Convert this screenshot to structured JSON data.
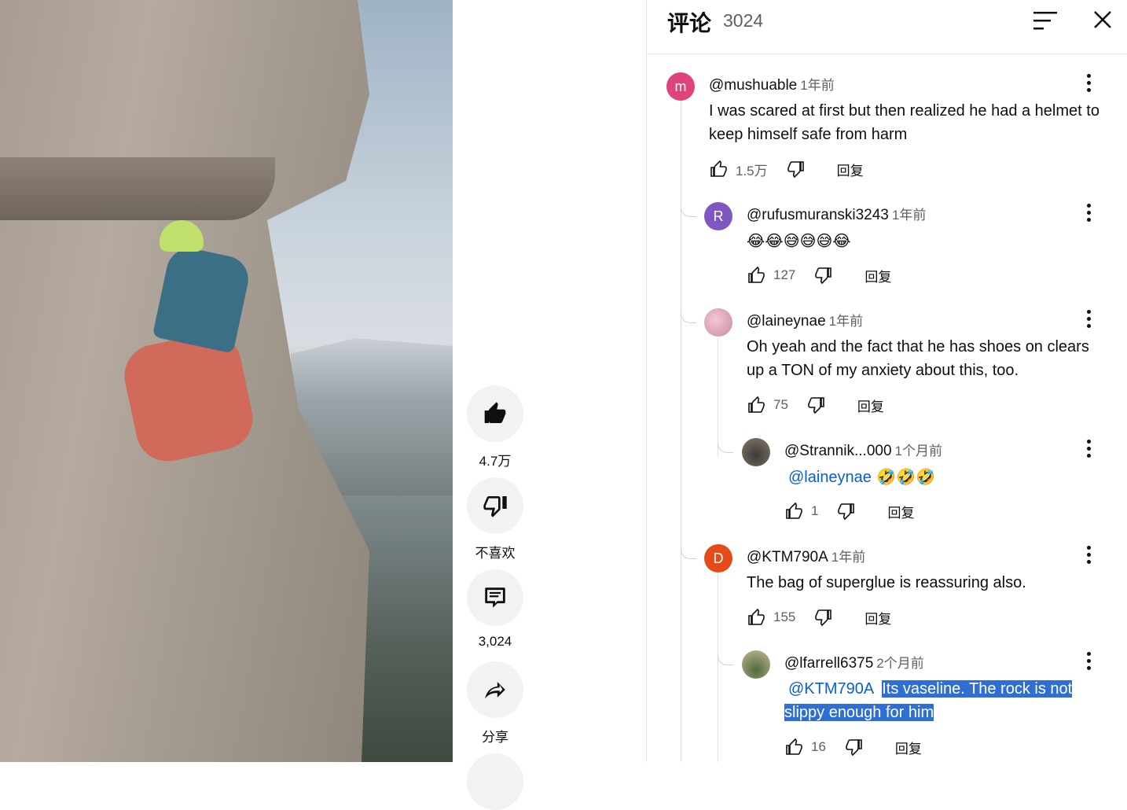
{
  "actions": {
    "like_count": "4.7万",
    "dislike_label": "不喜欢",
    "comment_count": "3,024",
    "share_label": "分享"
  },
  "panel": {
    "title": "评论",
    "count": "3024"
  },
  "comments": [
    {
      "author": "@mushuable",
      "time": "1年前",
      "avatar_letter": "m",
      "avatar_color": "#e0427a",
      "text": "I was scared at first but then realized he had a helmet to keep himself safe from harm",
      "likes": "1.5万",
      "reply": "回复"
    },
    {
      "author": "@rufusmuranski3243",
      "time": "1年前",
      "avatar_letter": "R",
      "avatar_color": "#7e57c2",
      "text": "😂😂😅😅😅😂",
      "likes": "127",
      "reply": "回复"
    },
    {
      "author": "@laineynae",
      "time": "1年前",
      "avatar_color": "#e8b4c4",
      "text": "Oh yeah and the fact that he has shoes on clears up a TON of my anxiety about this, too.",
      "likes": "75",
      "reply": "回复"
    },
    {
      "author": "@Strannik...000",
      "time": "1个月前",
      "avatar_color": "#6b5e4e",
      "mention": "@laineynae",
      "text": " 🤣🤣🤣",
      "likes": "1",
      "reply": "回复"
    },
    {
      "author": "@KTM790A",
      "time": "1年前",
      "avatar_letter": "D",
      "avatar_color": "#e64a19",
      "text": "The bag of superglue is reassuring also.",
      "likes": "155",
      "reply": "回复"
    },
    {
      "author": "@lfarrell6375",
      "time": "2个月前",
      "avatar_color": "#7a8a5e",
      "mention": "@KTM790A",
      "text": "Its vaseline. The rock is not slippy enough for him",
      "likes": "16",
      "reply": "回复"
    }
  ]
}
